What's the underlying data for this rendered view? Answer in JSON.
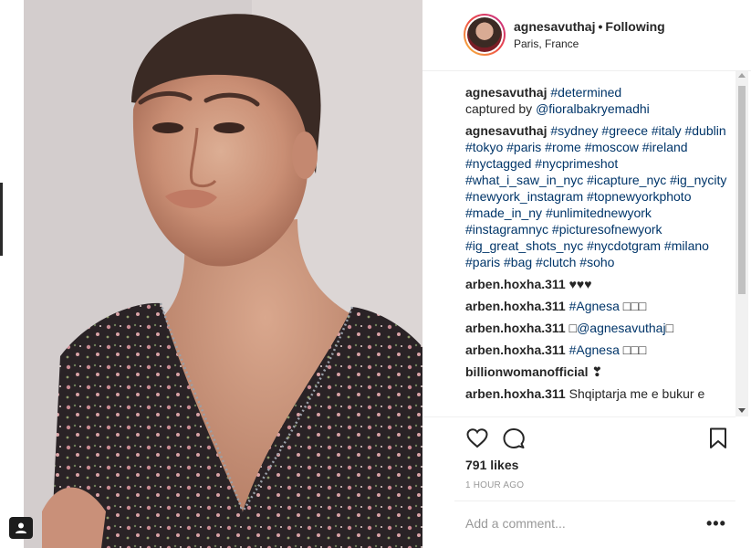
{
  "post": {
    "username": "agnesavuthaj",
    "follow_status": "Following",
    "location": "Paris, France",
    "likes": "791 likes",
    "time_ago": "1 HOUR AGO",
    "comment_placeholder": "Add a comment...",
    "more_label": "•••"
  },
  "caption": {
    "user": "agnesavuthaj",
    "tag": "#determined",
    "line2_prefix": "captured by ",
    "line2_mention": "@fioralbakryemadhi"
  },
  "hashtag_comment": {
    "user": "agnesavuthaj",
    "text": "#sydney #greece #italy #dublin #tokyo #paris #rome #moscow #ireland #nyctagged #nycprimeshot #what_i_saw_in_nyc #icapture_nyc #ig_nycity #newyork_instagram #topnewyorkphoto #made_in_ny #unlimitednewyork #instagramnyc #picturesofnewyork #ig_great_shots_nyc #nycdotgram #milano #paris #bag #clutch #soho"
  },
  "comments": [
    {
      "user": "arben.hoxha.311",
      "text": "♥♥♥",
      "link": ""
    },
    {
      "user": "arben.hoxha.311",
      "text": "",
      "link": "#Agnesa",
      "suffix": " □□□"
    },
    {
      "user": "arben.hoxha.311",
      "text": "□",
      "link": "@agnesavuthaj",
      "suffix": "□"
    },
    {
      "user": "arben.hoxha.311",
      "text": "",
      "link": "#Agnesa",
      "suffix": " □□□"
    },
    {
      "user": "billionwomanofficial",
      "text": "❣",
      "link": ""
    },
    {
      "user": "arben.hoxha.311",
      "text": "Shqiptarja me e bukur e",
      "link": ""
    }
  ],
  "icons": {
    "like": "heart-icon",
    "comment": "comment-icon",
    "save": "bookmark-icon",
    "user_tags": "user-tag-icon"
  },
  "colors": {
    "link": "#003569",
    "text": "#262626",
    "muted": "#999999",
    "border": "#efefef"
  }
}
